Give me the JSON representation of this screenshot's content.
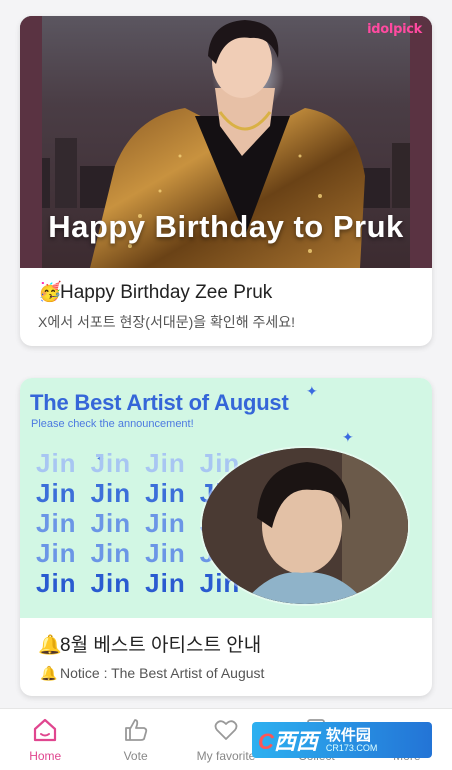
{
  "brand": {
    "logo": "idolpick"
  },
  "feed": {
    "items": [
      {
        "banner_caption": "Happy Birthday to Pruk",
        "emoji": "🥳",
        "title": "Happy Birthday Zee Pruk",
        "subtitle": "X에서 서포트 현장(서대문)을 확인해 주세요!"
      },
      {
        "banner_title": "The Best Artist of August",
        "banner_subtitle": "Please check the announcement!",
        "banner_word": "Jin",
        "emoji": "🔔",
        "title": "8월 베스트 아티스트 안내",
        "subtitle_emoji": "🔔",
        "subtitle": "Notice : The Best Artist of August"
      }
    ]
  },
  "nav": {
    "items": [
      {
        "label": "Home",
        "icon": "home-icon",
        "active": true
      },
      {
        "label": "Vote",
        "icon": "thumbs-up-icon",
        "active": false
      },
      {
        "label": "My favorite",
        "icon": "heart-icon",
        "active": false
      },
      {
        "label": "Collect",
        "icon": "collect-icon",
        "active": false
      },
      {
        "label": "More",
        "icon": "more-icon",
        "active": false
      }
    ]
  },
  "colors": {
    "accent": "#e0468f",
    "banner2_bg": "#d2f7e4",
    "banner2_text": "#3566d8"
  },
  "watermark": {
    "logo_c": "C",
    "logo_text": "西西",
    "right_text": "软件园",
    "url": "CR173.COM"
  }
}
